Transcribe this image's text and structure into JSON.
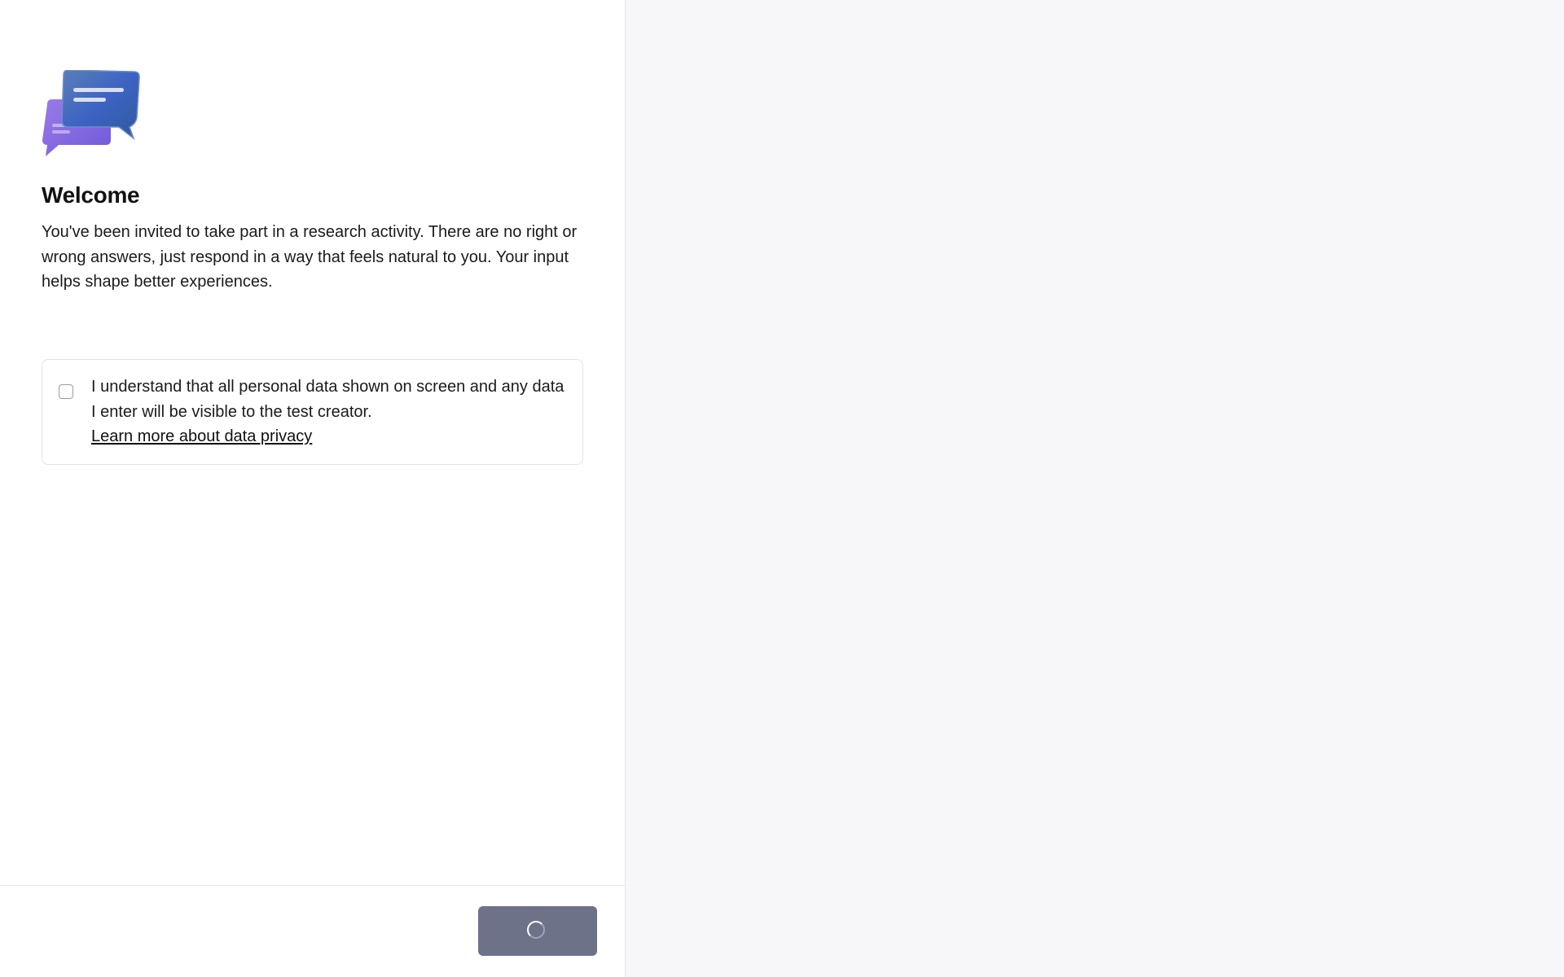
{
  "welcome": {
    "title": "Welcome",
    "description": "You've been invited to take part in a research activity. There are no right or wrong answers, just respond in a way that feels natural to you. Your input helps shape better experiences."
  },
  "consent": {
    "checked": false,
    "text_line1": "I understand that all personal data shown on screen and any data",
    "text_line2": "I enter will be visible to the test creator.",
    "link_label": "Learn more about data privacy"
  },
  "footer": {
    "button_state": "loading",
    "button_icon": "spinner-icon"
  },
  "colors": {
    "button": "#6e7289",
    "logo_front_bubble": "#3f68c9",
    "logo_back_bubble": "#8f6ce0"
  }
}
